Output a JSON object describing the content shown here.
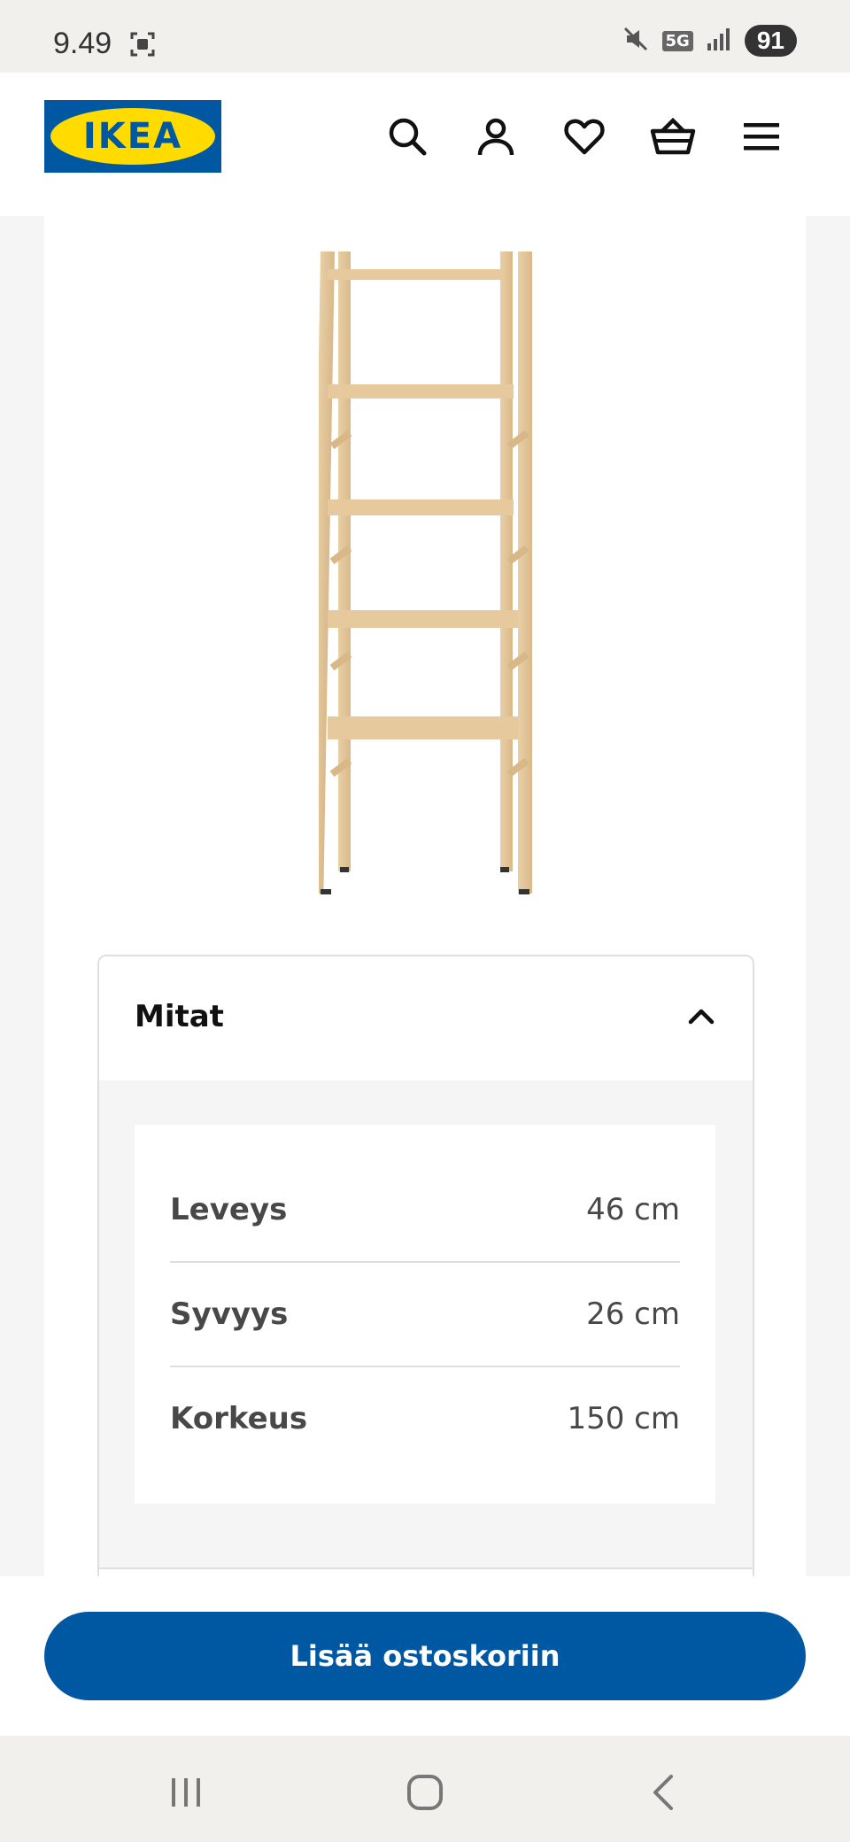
{
  "status": {
    "time": "9.49",
    "network": "5G",
    "battery": "91"
  },
  "header": {
    "logo_text": "IKEA"
  },
  "icons": {
    "search": "search-icon",
    "account": "user-icon",
    "favorites": "heart-icon",
    "cart": "basket-icon",
    "menu": "hamburger-menu-icon"
  },
  "accordion": {
    "title": "Mitat"
  },
  "dimensions": [
    {
      "label": "Leveys",
      "value": "46 cm"
    },
    {
      "label": "Syvyys",
      "value": "26 cm"
    },
    {
      "label": "Korkeus",
      "value": "150 cm"
    }
  ],
  "cta": {
    "label": "Lisää ostoskoriin"
  },
  "colors": {
    "brand_blue": "#0058a3",
    "brand_yellow": "#ffdb00"
  }
}
